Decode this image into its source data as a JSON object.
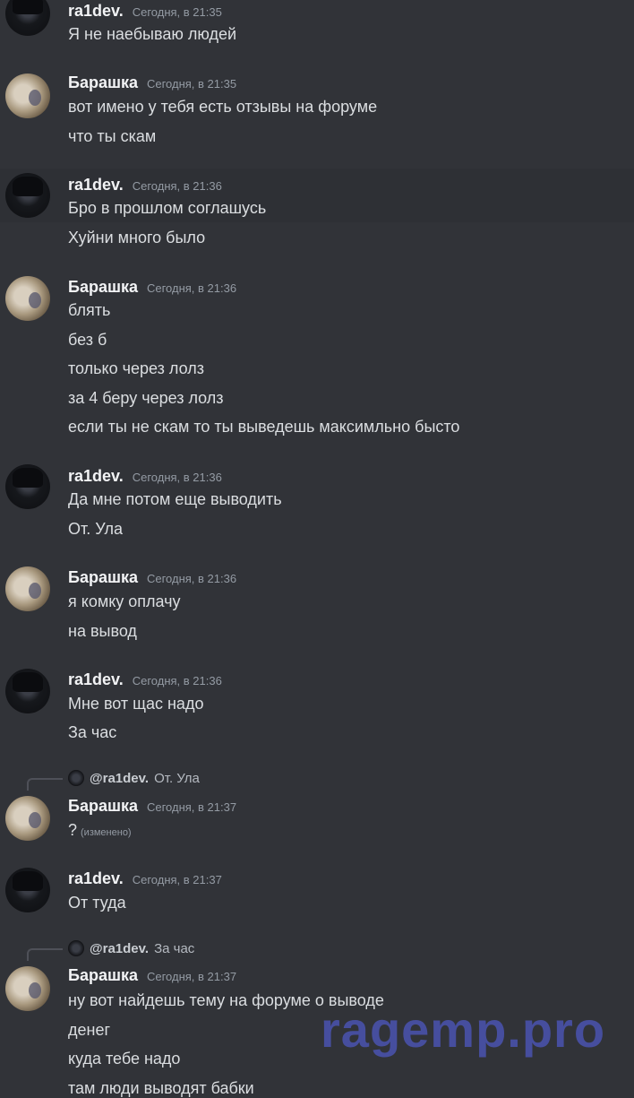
{
  "messages": [
    {
      "author": "ra1dev.",
      "time": "Сегодня, в 21:35",
      "lines": [
        "Я не наебываю людей"
      ]
    },
    {
      "author": "Барашка",
      "time": "Сегодня, в 21:35",
      "lines": [
        "вот имено у тебя есть отзывы на форуме",
        "что ты скам"
      ]
    },
    {
      "author": "ra1dev.",
      "time": "Сегодня, в 21:36",
      "lines": [
        "Бро в прошлом соглашусь",
        "Хуйни много было"
      ]
    },
    {
      "author": "Барашка",
      "time": "Сегодня, в 21:36",
      "lines": [
        "блять",
        "без б",
        "только через лолз",
        "за 4 беру через лолз",
        "если ты не скам то ты выведешь максимльно бысто"
      ]
    },
    {
      "author": "ra1dev.",
      "time": "Сегодня, в 21:36",
      "lines": [
        "Да мне потом еще выводить",
        "От. Ула"
      ]
    },
    {
      "author": "Барашка",
      "time": "Сегодня, в 21:36",
      "lines": [
        "я комку оплачу",
        "на вывод"
      ]
    },
    {
      "author": "ra1dev.",
      "time": "Сегодня, в 21:36",
      "lines": [
        "Мне вот щас надо",
        "За час"
      ]
    },
    {
      "author": "Барашка",
      "time": "Сегодня, в 21:37",
      "reply": {
        "author": "@ra1dev.",
        "text": "От. Ула"
      },
      "lines": [
        "?"
      ],
      "edited": "(изменено)"
    },
    {
      "author": "ra1dev.",
      "time": "Сегодня, в 21:37",
      "lines": [
        "От туда"
      ]
    },
    {
      "author": "Барашка",
      "time": "Сегодня, в 21:37",
      "reply": {
        "author": "@ra1dev.",
        "text": "За час"
      },
      "lines": [
        "ну вот найдешь тему на форуме о выводе",
        "денег",
        "куда тебе надо",
        "там люди выводят бабки"
      ]
    }
  ],
  "watermark": "ragemp.pro"
}
